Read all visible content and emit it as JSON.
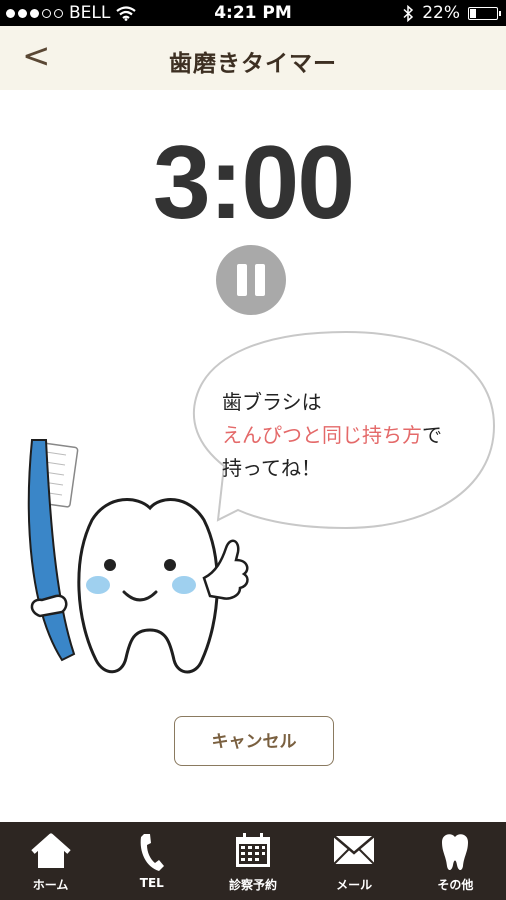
{
  "status_bar": {
    "carrier": "BELL",
    "time": "4:21 PM",
    "battery": "22%",
    "battery_level": 0.22
  },
  "header": {
    "back_label": "<",
    "title": "歯磨きタイマー"
  },
  "timer": {
    "display": "3:00"
  },
  "bubble": {
    "line1": "歯ブラシは",
    "line2_highlight": "えんぴつと同じ持ち方",
    "line2_rest": "で",
    "line3": "持ってね！"
  },
  "actions": {
    "cancel_label": "キャンセル"
  },
  "tabbar": {
    "items": [
      {
        "label": "ホーム",
        "icon": "home-icon"
      },
      {
        "label": "TEL",
        "icon": "phone-icon"
      },
      {
        "label": "診察予約",
        "icon": "calendar-icon"
      },
      {
        "label": "メール",
        "icon": "mail-icon"
      },
      {
        "label": "その他",
        "icon": "tooth-icon"
      }
    ]
  },
  "colors": {
    "navbar_bg": "#f7f4ea",
    "tabbar_bg": "#2d2622",
    "highlight": "#e46969",
    "toothbrush": "#3a86c8"
  }
}
